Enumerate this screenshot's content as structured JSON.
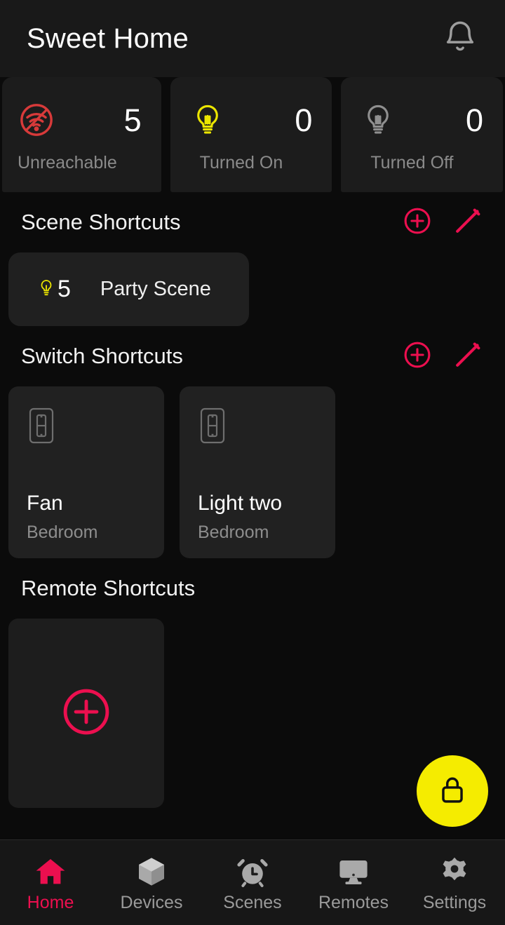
{
  "header": {
    "title": "Sweet Home",
    "notification_icon": "bell-icon"
  },
  "stats": [
    {
      "icon": "wifi-off-icon",
      "value": "5",
      "label": "Unreachable",
      "color": "#d83a3a"
    },
    {
      "icon": "lightbulb-on-icon",
      "value": "0",
      "label": "Turned On",
      "color": "#ece600"
    },
    {
      "icon": "lightbulb-off-icon",
      "value": "0",
      "label": "Turned Off",
      "color": "#8f8f8f"
    }
  ],
  "sections": {
    "scene": {
      "title": "Scene Shortcuts",
      "add_icon": "plus-circle-icon",
      "edit_icon": "pencil-icon",
      "items": [
        {
          "count": "5",
          "name": "Party Scene",
          "icon": "lightbulb-icon"
        }
      ]
    },
    "switch": {
      "title": "Switch Shortcuts",
      "add_icon": "plus-circle-icon",
      "edit_icon": "pencil-icon",
      "items": [
        {
          "name": "Fan",
          "room": "Bedroom",
          "icon": "light-switch-icon"
        },
        {
          "name": "Light two",
          "room": "Bedroom",
          "icon": "light-switch-icon"
        }
      ]
    },
    "remote": {
      "title": "Remote Shortcuts",
      "add_icon": "plus-circle-icon"
    }
  },
  "fab": {
    "icon": "lock-icon",
    "color": "#f5ec00"
  },
  "bottom_nav": {
    "active_color": "#ec0f4f",
    "items": [
      {
        "label": "Home",
        "icon": "house-icon",
        "active": true
      },
      {
        "label": "Devices",
        "icon": "cube-icon",
        "active": false
      },
      {
        "label": "Scenes",
        "icon": "alarm-clock-icon",
        "active": false
      },
      {
        "label": "Remotes",
        "icon": "monitor-icon",
        "active": false
      },
      {
        "label": "Settings",
        "icon": "gear-icon",
        "active": false
      }
    ]
  },
  "theme": {
    "accent_pink": "#ec0f4f",
    "accent_yellow": "#ece600",
    "background": "#0b0b0b",
    "card": "#1e1e1e"
  }
}
